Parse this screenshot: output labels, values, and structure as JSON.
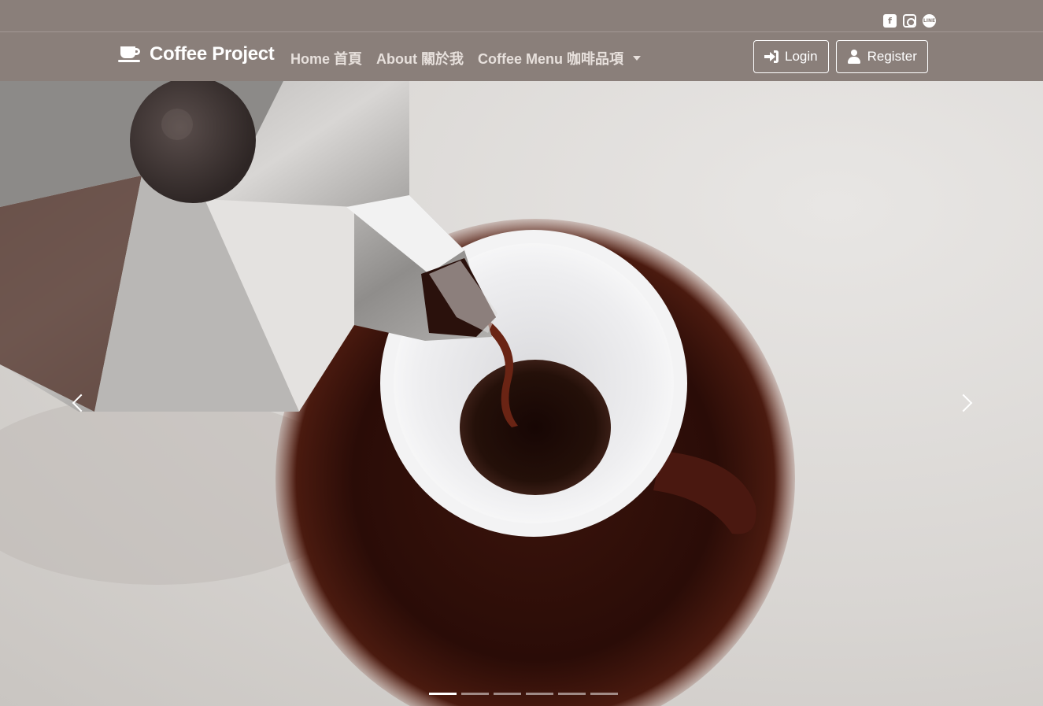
{
  "social": {
    "items": [
      {
        "name": "facebook",
        "glyph": "f"
      },
      {
        "name": "instagram",
        "glyph": ""
      },
      {
        "name": "line",
        "glyph": "LINE"
      }
    ]
  },
  "navbar": {
    "brand": "Coffee Project",
    "links": [
      {
        "label": "Home 首頁"
      },
      {
        "label": "About 關於我"
      },
      {
        "label": "Coffee Menu 咖啡品項"
      }
    ],
    "login_label": "Login",
    "register_label": "Register"
  },
  "colors": {
    "navbar_bg": "#8a7f7a",
    "nav_text": "#e7e0dc"
  },
  "carousel": {
    "slide_count": 6,
    "active_index": 0
  }
}
